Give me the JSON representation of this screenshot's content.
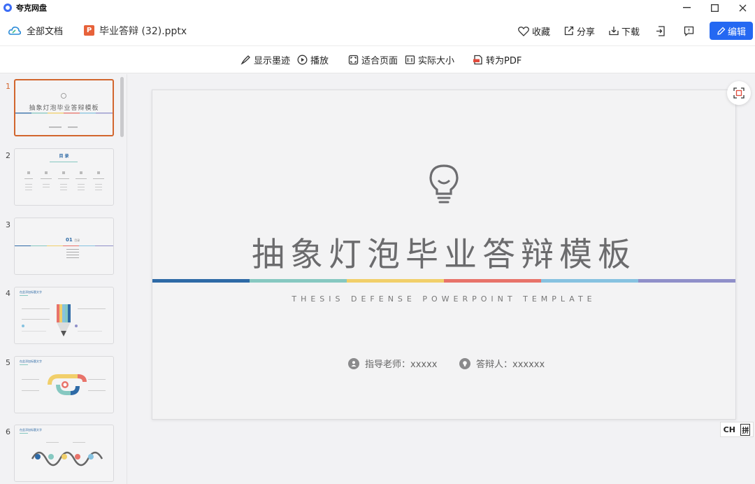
{
  "app": {
    "title": "夸克网盘"
  },
  "header": {
    "all_docs": "全部文档",
    "file_badge": "P",
    "file_name": "毕业答辩 (32).pptx",
    "favorite": "收藏",
    "share": "分享",
    "download": "下载",
    "edit": "编辑"
  },
  "toolbar": {
    "ink": "显示墨迹",
    "play": "播放",
    "fit_page": "适合页面",
    "actual_size": "实际大小",
    "to_pdf": "转为PDF"
  },
  "thumbnails": [
    {
      "num": "1"
    },
    {
      "num": "2"
    },
    {
      "num": "3"
    },
    {
      "num": "4"
    },
    {
      "num": "5"
    },
    {
      "num": "6"
    }
  ],
  "slide": {
    "title": "抽象灯泡毕业答辩模板",
    "subtitle": "THESIS DEFENSE POWERPOINT TEMPLATE",
    "advisor": "指导老师：xxxxx",
    "defender": "答辩人：xxxxxx",
    "stripe_colors": [
      "#2e6aa6",
      "#86c8c1",
      "#f1cf6a",
      "#e8736a",
      "#86c2e0",
      "#8f8fc9"
    ]
  },
  "thumb_text": {
    "t1_title": "抽象灯泡毕业答辩模板",
    "t2_title": "目 录",
    "t3_title": "01",
    "t3_title_suffix": "目录",
    "t4_title": "在此添加标题文字",
    "t5_title": "在此添加标题文字",
    "t6_title": "在此添加标题文字"
  },
  "ime": {
    "lang": "CH",
    "mode": "拼"
  }
}
